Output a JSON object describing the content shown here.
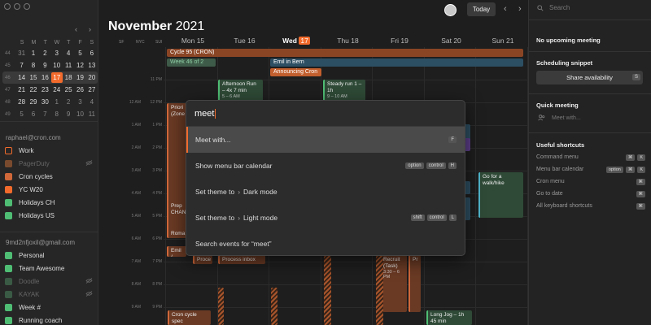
{
  "sidebar": {
    "mini_calendar": {
      "prev": "‹",
      "next": "›",
      "weekday_headers": [
        "S",
        "M",
        "T",
        "W",
        "T",
        "F",
        "S"
      ],
      "weeks": [
        {
          "num": "44",
          "days": [
            "31",
            "1",
            "2",
            "3",
            "4",
            "5",
            "6"
          ]
        },
        {
          "num": "45",
          "days": [
            "7",
            "8",
            "9",
            "10",
            "11",
            "12",
            "13"
          ]
        },
        {
          "num": "46",
          "days": [
            "14",
            "15",
            "16",
            "17",
            "18",
            "19",
            "20"
          ]
        },
        {
          "num": "47",
          "days": [
            "21",
            "22",
            "23",
            "24",
            "25",
            "26",
            "27"
          ]
        },
        {
          "num": "48",
          "days": [
            "28",
            "29",
            "30",
            "1",
            "2",
            "3",
            "4"
          ]
        },
        {
          "num": "49",
          "days": [
            "5",
            "6",
            "7",
            "8",
            "9",
            "10",
            "11"
          ]
        }
      ]
    },
    "account1": "raphael@cron.com",
    "calendars1": [
      {
        "label": "Work",
        "color": "#f26b2c",
        "dim": false,
        "hidden": false,
        "outline": true
      },
      {
        "label": "PagerDuty",
        "color": "#7a4a2e",
        "dim": true,
        "hidden": true,
        "outline": false
      },
      {
        "label": "Cron cycles",
        "color": "#d0683a",
        "dim": false,
        "hidden": false,
        "outline": false
      },
      {
        "label": "YC W20",
        "color": "#f26b2c",
        "dim": false,
        "hidden": false,
        "outline": false
      },
      {
        "label": "Holidays CH",
        "color": "#4fbd74",
        "dim": false,
        "hidden": false,
        "outline": false
      },
      {
        "label": "Holidays US",
        "color": "#4fbd74",
        "dim": false,
        "hidden": false,
        "outline": false
      }
    ],
    "account2": "9md2nfjoxil@gmail.com",
    "calendars2": [
      {
        "label": "Personal",
        "color": "#4fbd74",
        "dim": false,
        "hidden": false,
        "outline": false
      },
      {
        "label": "Team Awesome",
        "color": "#4fbd74",
        "dim": false,
        "hidden": false,
        "outline": false
      },
      {
        "label": "Doodle",
        "color": "#3a5a45",
        "dim": true,
        "hidden": true,
        "outline": false
      },
      {
        "label": "KAYAK",
        "color": "#3a5a45",
        "dim": true,
        "hidden": true,
        "outline": false
      },
      {
        "label": "Week #",
        "color": "#4fbd74",
        "dim": false,
        "hidden": false,
        "outline": false
      },
      {
        "label": "Running coach",
        "color": "#4fbd74",
        "dim": false,
        "hidden": false,
        "outline": false
      }
    ]
  },
  "header": {
    "month": "November",
    "year": "2021",
    "today_label": "Today",
    "prev": "‹",
    "next": "›"
  },
  "timezones": [
    "SF",
    "NYC",
    "SUI"
  ],
  "days": [
    {
      "label": "Mon 15",
      "today": false
    },
    {
      "label": "Tue 16",
      "today": false
    },
    {
      "label": "Wed",
      "badge": "17",
      "today": true
    },
    {
      "label": "Thu 18",
      "today": false
    },
    {
      "label": "Fri 19",
      "today": false
    },
    {
      "label": "Sat 20",
      "today": false
    },
    {
      "label": "Sun 21",
      "today": false
    }
  ],
  "time_rows": [
    {
      "sf": "",
      "nyc": "",
      "sui": "11 PM"
    },
    {
      "sf": "",
      "nyc": "12 AM",
      "sui": "12 PM"
    },
    {
      "sf": "",
      "nyc": "1 AM",
      "sui": "1 PM"
    },
    {
      "sf": "",
      "nyc": "2 AM",
      "sui": "2 PM"
    },
    {
      "sf": "",
      "nyc": "3 AM",
      "sui": "3 PM"
    },
    {
      "sf": "",
      "nyc": "4 AM",
      "sui": "4 PM"
    },
    {
      "sf": "",
      "nyc": "5 AM",
      "sui": "5 PM"
    },
    {
      "sf": "",
      "nyc": "6 AM",
      "sui": "6 PM"
    },
    {
      "sf": "",
      "nyc": "7 AM",
      "sui": "7 PM"
    },
    {
      "sf": "",
      "nyc": "8 AM",
      "sui": "8 PM"
    },
    {
      "sf": "",
      "nyc": "9 AM",
      "sui": "9 PM"
    },
    {
      "sf": "",
      "nyc": "10 AM",
      "sui": "10 PM"
    }
  ],
  "allday_events": {
    "cycle": "Cycle 95 (CRON)",
    "week": "Week 46 of 2",
    "emil": "Emil in Bern",
    "announcing": "Announcing Cron"
  },
  "events": {
    "afternoon_run": {
      "title": "Afternoon Run – 4x 7 min",
      "time": "5 – 6 AM"
    },
    "steady_run": {
      "title": "Steady run 1 – 1h",
      "time": "9 – 10 AM"
    },
    "prioritize": {
      "title": "Priori (Zone"
    },
    "prep": {
      "title": "Prep CHAN"
    },
    "roma": {
      "title": "Roma"
    },
    "emil_mon": {
      "title": "Emil /"
    },
    "proce": {
      "title": "Proce"
    },
    "process_inbox": {
      "title": "Process inbox"
    },
    "recruit": {
      "title": "Recruit (Task)",
      "time": "3:30 – 6 PM"
    },
    "pr": {
      "title": "Pr"
    },
    "go_walk": {
      "title": "Go for a walk/hike"
    },
    "cron_cycle": {
      "title": "Cron cycle spec"
    },
    "long_jog": {
      "title": "Long Jog – 1h 45 min"
    }
  },
  "palette": {
    "query": "meet",
    "items": [
      {
        "label": "Meet with...",
        "keys": [
          "F"
        ],
        "selected": true
      },
      {
        "label": "Show menu bar calendar",
        "keys": [
          "option",
          "control",
          "H"
        ],
        "selected": false
      },
      {
        "label": "Set theme to",
        "arrow": "›",
        "target": "Dark mode",
        "keys": [],
        "selected": false
      },
      {
        "label": "Set theme to",
        "arrow": "›",
        "target": "Light mode",
        "keys": [
          "shift",
          "control",
          "L"
        ],
        "selected": false
      },
      {
        "label": "Search events for “meet”",
        "keys": [],
        "selected": false
      }
    ]
  },
  "right_panel": {
    "search_placeholder": "Search",
    "no_meeting": "No upcoming meeting",
    "scheduling_title": "Scheduling snippet",
    "share_label": "Share availability",
    "share_key": "S",
    "quick_title": "Quick meeting",
    "quick_placeholder": "Meet with...",
    "shortcuts_title": "Useful shortcuts",
    "shortcuts": [
      {
        "label": "Command menu",
        "keys": [
          "⌘",
          "K"
        ]
      },
      {
        "label": "Menu bar calendar",
        "keys": [
          "option",
          "⌘",
          "K"
        ]
      },
      {
        "label": "Cron menu",
        "keys": [
          "⌘"
        ]
      },
      {
        "label": "Go to date",
        "keys": [
          "⌘"
        ]
      },
      {
        "label": "All keyboard shortcuts",
        "keys": [
          "⌘"
        ]
      }
    ]
  }
}
